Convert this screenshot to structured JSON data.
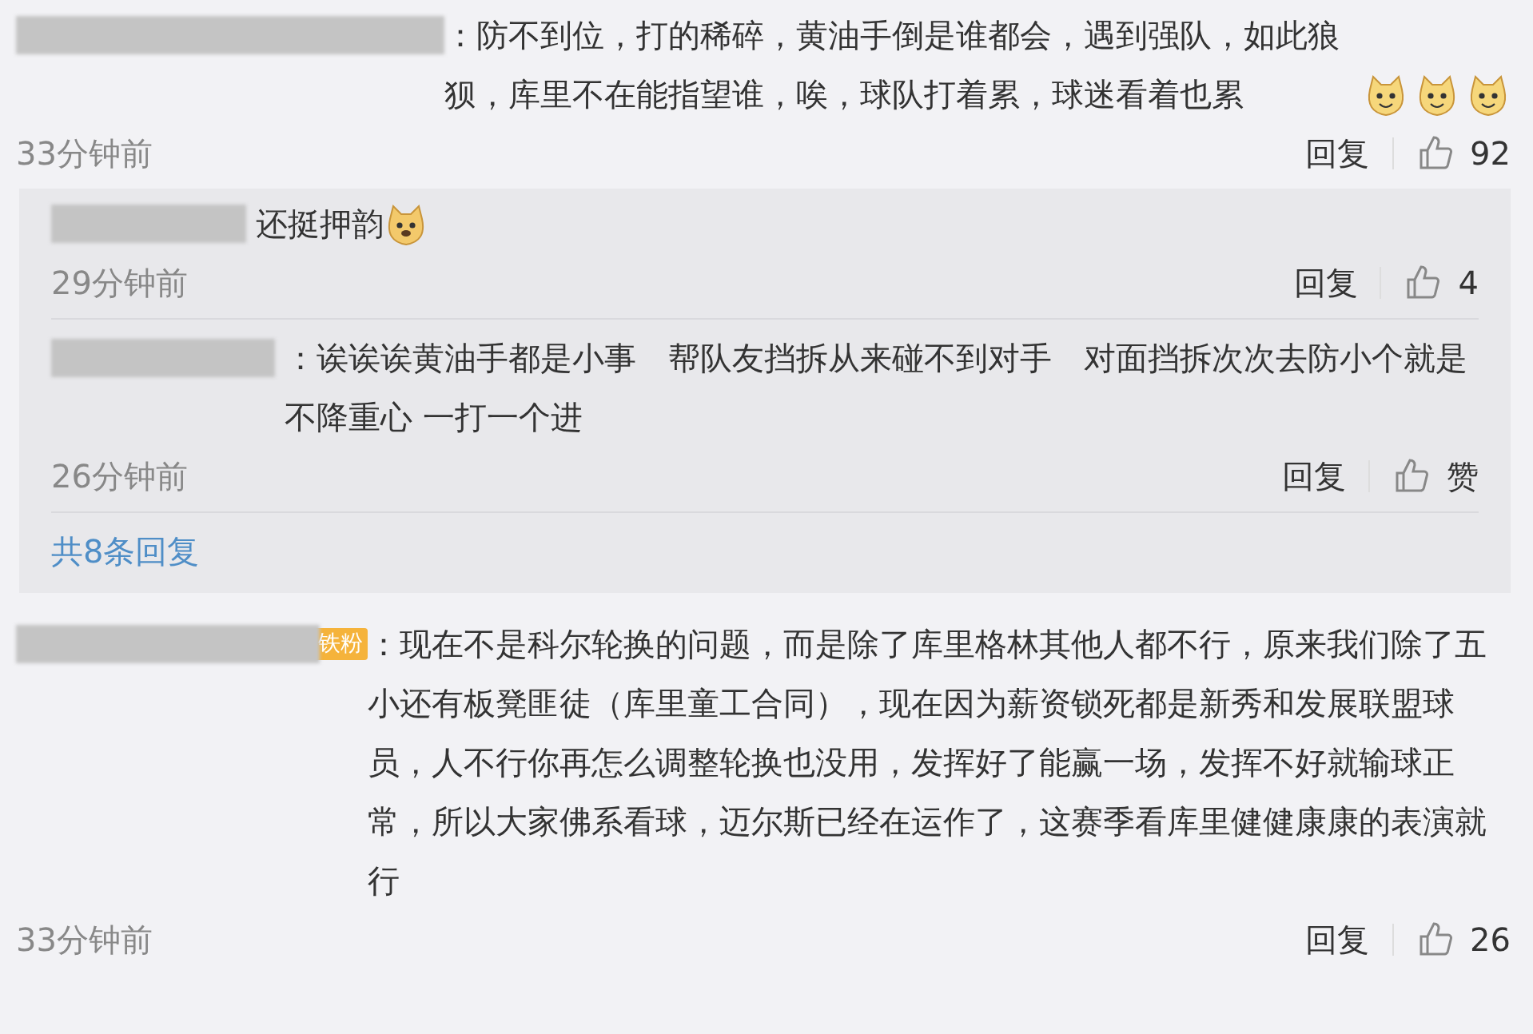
{
  "comments": [
    {
      "text": "：防不到位，打的稀碎，黄油手倒是谁都会，遇到强队，如此狼狈，库里不在能指望谁，唉，球队打着累，球迷看着也累",
      "emojis": [
        {
          "kind": "cat"
        },
        {
          "kind": "cat"
        },
        {
          "kind": "cat"
        }
      ],
      "time": "33分钟前",
      "reply": "回复",
      "likes": "92",
      "replies": [
        {
          "text": "还挺押韵",
          "emojis": [
            {
              "kind": "dog"
            }
          ],
          "time": "29分钟前",
          "reply": "回复",
          "likes": "4"
        },
        {
          "text": "：诶诶诶黄油手都是小事　帮队友挡拆从来碰不到对手　对面挡拆次次去防小个就是不降重心 一打一个进",
          "time": "26分钟前",
          "reply": "回复",
          "likes": "赞"
        }
      ],
      "more": "共8条回复"
    },
    {
      "badge": "铁粉",
      "text": "：现在不是科尔轮换的问题，而是除了库里格林其他人都不行，原来我们除了五小还有板凳匪徒（库里童工合同），现在因为薪资锁死都是新秀和发展联盟球员，人不行你再怎么调整轮换也没用，发挥好了能赢一场，发挥不好就输球正常，所以大家佛系看球，迈尔斯已经在运作了，这赛季看库里健健康康的表演就行",
      "time": "33分钟前",
      "reply": "回复",
      "likes": "26"
    }
  ]
}
